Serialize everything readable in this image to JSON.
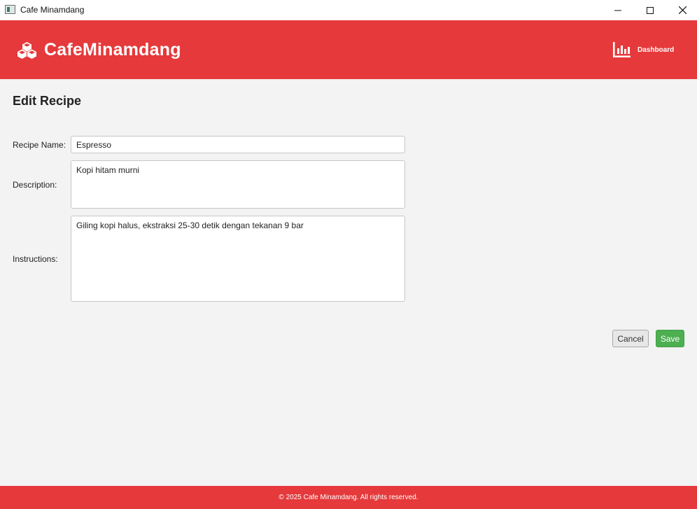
{
  "window": {
    "title": "Cafe Minamdang",
    "icon": "app-window-icon",
    "controls": [
      "minimize-icon",
      "maximize-icon",
      "close-icon"
    ]
  },
  "header": {
    "brand_name": "CafeMinamdang",
    "brand_icon": "cubes-icon",
    "nav": {
      "dashboard_label": "Dashboard",
      "dashboard_icon": "bar-chart-icon"
    }
  },
  "main": {
    "title": "Edit Recipe",
    "form": {
      "recipe_name": {
        "label": "Recipe Name:",
        "value": "Espresso"
      },
      "description": {
        "label": "Description:",
        "value": "Kopi hitam murni"
      },
      "instructions": {
        "label": "Instructions:",
        "value": "Giling kopi halus, ekstraksi 25-30 detik dengan tekanan 9 bar"
      }
    },
    "actions": {
      "cancel_label": "Cancel",
      "save_label": "Save"
    }
  },
  "footer": {
    "copyright": "© 2025 Cafe Minamdang. All rights reserved."
  },
  "colors": {
    "brand": "#e5393b",
    "save": "#4caf50",
    "background": "#f3f3f3"
  }
}
